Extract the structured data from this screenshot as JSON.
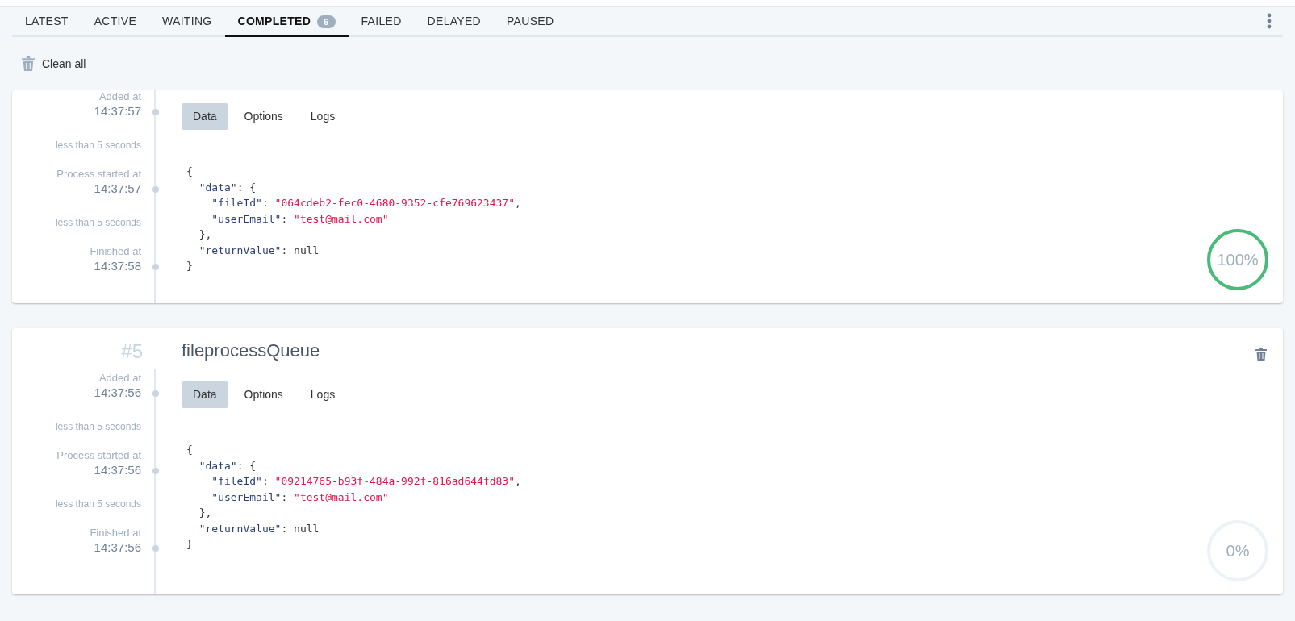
{
  "tabs": [
    {
      "label": "LATEST",
      "selected": false
    },
    {
      "label": "ACTIVE",
      "selected": false
    },
    {
      "label": "WAITING",
      "selected": false
    },
    {
      "label": "COMPLETED",
      "selected": true,
      "badge": "6"
    },
    {
      "label": "FAILED",
      "selected": false
    },
    {
      "label": "DELAYED",
      "selected": false
    },
    {
      "label": "PAUSED",
      "selected": false
    }
  ],
  "clean_all": "Clean all",
  "jobs": [
    {
      "timeline": [
        {
          "kind": "event",
          "label": "Added at",
          "time": "14:37:57"
        },
        {
          "kind": "duration",
          "label": "less than 5 seconds"
        },
        {
          "kind": "event",
          "label": "Process started at",
          "time": "14:37:57"
        },
        {
          "kind": "duration",
          "label": "less than 5 seconds"
        },
        {
          "kind": "event",
          "label": "Finished at",
          "time": "14:37:58"
        }
      ],
      "detail_tabs": [
        {
          "label": "Data",
          "selected": true
        },
        {
          "label": "Options",
          "selected": false
        },
        {
          "label": "Logs",
          "selected": false
        }
      ],
      "code": [
        [
          {
            "kind": "punct",
            "t": "{"
          }
        ],
        [
          {
            "kind": "key",
            "t": "  \"data\""
          },
          {
            "kind": "punct",
            "t": ": {"
          }
        ],
        [
          {
            "kind": "key",
            "t": "    \"fileId\""
          },
          {
            "kind": "punct",
            "t": ": "
          },
          {
            "kind": "string",
            "t": "\"064cdeb2-fec0-4680-9352-cfe769623437\""
          },
          {
            "kind": "punct",
            "t": ","
          }
        ],
        [
          {
            "kind": "key",
            "t": "    \"userEmail\""
          },
          {
            "kind": "punct",
            "t": ": "
          },
          {
            "kind": "string",
            "t": "\"test@mail.com\""
          }
        ],
        [
          {
            "kind": "punct",
            "t": "  },"
          }
        ],
        [
          {
            "kind": "key",
            "t": "  \"returnValue\""
          },
          {
            "kind": "punct",
            "t": ": null"
          }
        ],
        [
          {
            "kind": "punct",
            "t": "}"
          }
        ]
      ],
      "progress": {
        "level": 1,
        "reading": "100%"
      }
    },
    {
      "number": "#5",
      "name": "fileprocessQueue",
      "timeline": [
        {
          "kind": "event",
          "label": "Added at",
          "time": "14:37:56"
        },
        {
          "kind": "duration",
          "label": "less than 5 seconds"
        },
        {
          "kind": "event",
          "label": "Process started at",
          "time": "14:37:56"
        },
        {
          "kind": "duration",
          "label": "less than 5 seconds"
        },
        {
          "kind": "event",
          "label": "Finished at",
          "time": "14:37:56"
        }
      ],
      "detail_tabs": [
        {
          "label": "Data",
          "selected": true
        },
        {
          "label": "Options",
          "selected": false
        },
        {
          "label": "Logs",
          "selected": false
        }
      ],
      "code": [
        [
          {
            "kind": "punct",
            "t": "{"
          }
        ],
        [
          {
            "kind": "key",
            "t": "  \"data\""
          },
          {
            "kind": "punct",
            "t": ": {"
          }
        ],
        [
          {
            "kind": "key",
            "t": "    \"fileId\""
          },
          {
            "kind": "punct",
            "t": ": "
          },
          {
            "kind": "string",
            "t": "\"09214765-b93f-484a-992f-816ad644fd83\""
          },
          {
            "kind": "punct",
            "t": ","
          }
        ],
        [
          {
            "kind": "key",
            "t": "    \"userEmail\""
          },
          {
            "kind": "punct",
            "t": ": "
          },
          {
            "kind": "string",
            "t": "\"test@mail.com\""
          }
        ],
        [
          {
            "kind": "punct",
            "t": "  },"
          }
        ],
        [
          {
            "kind": "key",
            "t": "  \"returnValue\""
          },
          {
            "kind": "punct",
            "t": ": null"
          }
        ],
        [
          {
            "kind": "punct",
            "t": "}"
          }
        ]
      ],
      "progress": {
        "level": 0,
        "reading": "0%"
      }
    }
  ]
}
